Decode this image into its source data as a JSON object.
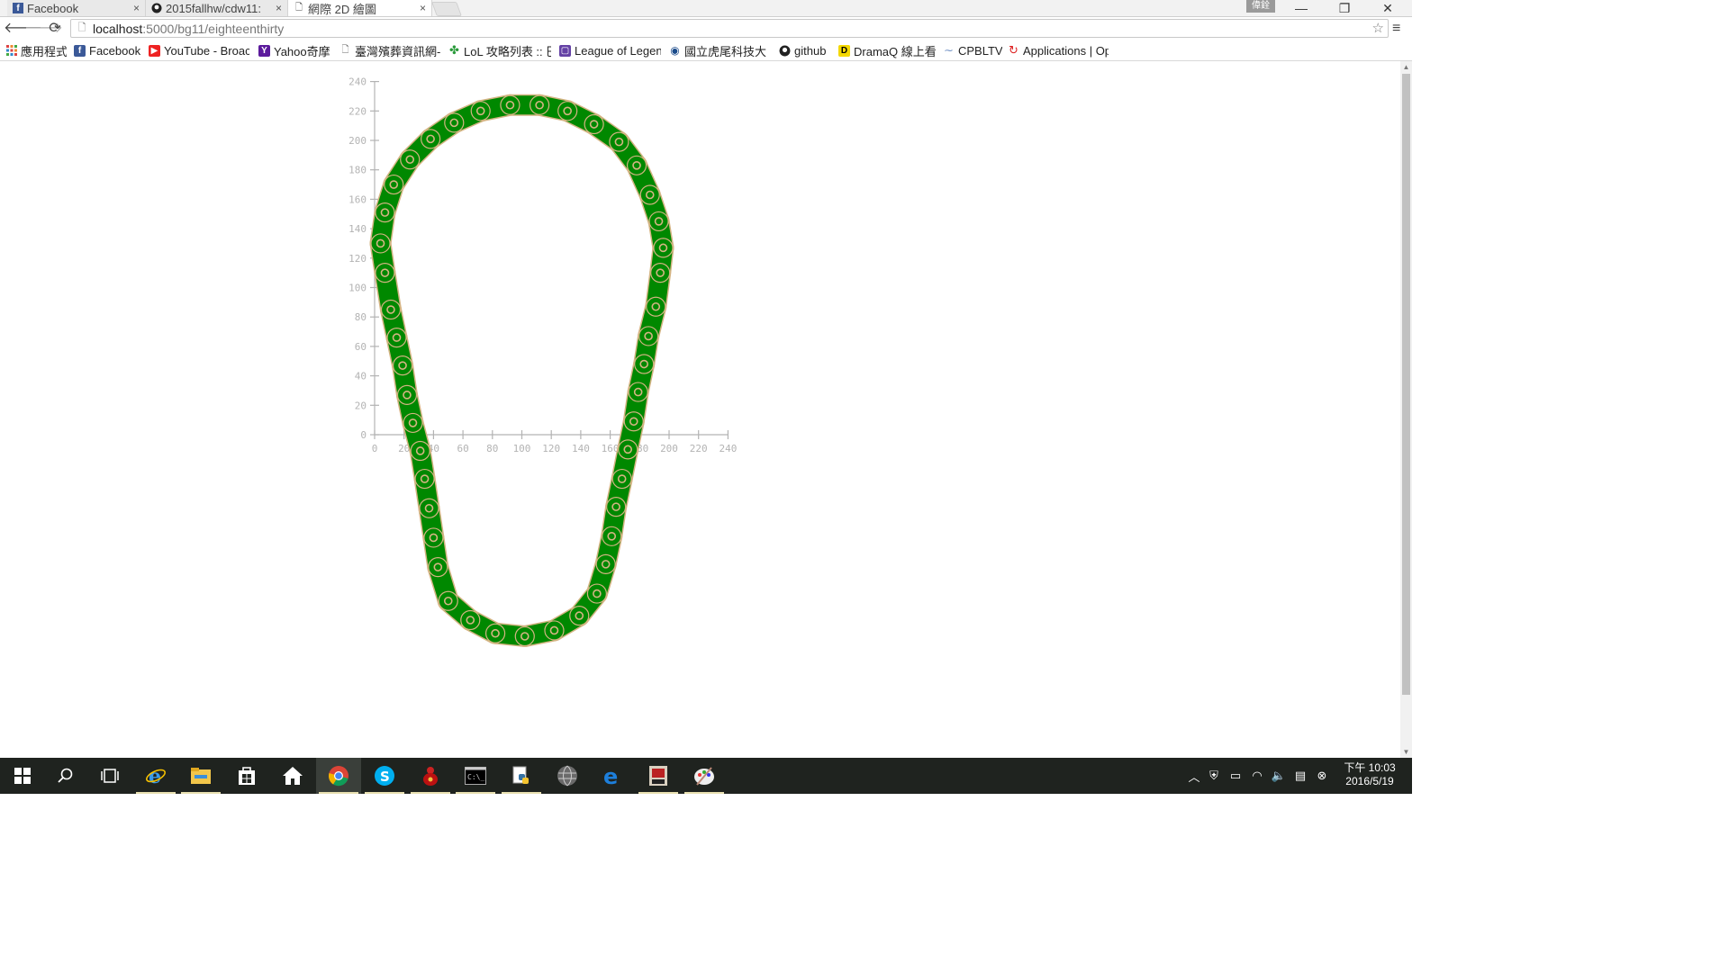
{
  "tabs": [
    {
      "label": "Facebook",
      "icon": "facebook-icon",
      "active": false
    },
    {
      "label": "2015fallhw/cdw11:",
      "icon": "github-icon",
      "active": false
    },
    {
      "label": "網際 2D 繪圖",
      "icon": "page-icon",
      "active": true
    }
  ],
  "window": {
    "profile_label": "偉銓",
    "minimize": "—",
    "restore": "❐",
    "close": "✕"
  },
  "toolbar": {
    "url_host": "localhost",
    "url_path": ":5000/bg11/eighteenthirty"
  },
  "bookmarks": [
    {
      "label": "應用程式",
      "icon": "apps-grid-icon"
    },
    {
      "label": "Facebook",
      "icon": "facebook-icon"
    },
    {
      "label": "YouTube - Broac",
      "icon": "youtube-icon"
    },
    {
      "label": "Yahoo奇摩",
      "icon": "yahoo-icon"
    },
    {
      "label": "臺灣殯葬資訊網-",
      "icon": "page-icon"
    },
    {
      "label": "LoL 攻略列表 :: 巴",
      "icon": "clover-icon"
    },
    {
      "label": "League of Legen",
      "icon": "twitch-icon"
    },
    {
      "label": "國立虎尾科技大",
      "icon": "school-icon"
    },
    {
      "label": "github",
      "icon": "github-icon"
    },
    {
      "label": "DramaQ 線上看",
      "icon": "dramaq-icon"
    },
    {
      "label": "CPBLTV",
      "icon": "cpbl-icon"
    },
    {
      "label": "Applications | Op",
      "icon": "openshift-icon"
    }
  ],
  "chart_data": {
    "type": "scatter",
    "title": "",
    "xlabel": "",
    "ylabel": "",
    "xlim": [
      0,
      240
    ],
    "ylim": [
      0,
      240
    ],
    "x_ticks": [
      0,
      20,
      40,
      60,
      80,
      100,
      120,
      140,
      160,
      180,
      200,
      220,
      240
    ],
    "y_ticks": [
      0,
      20,
      40,
      60,
      80,
      100,
      120,
      140,
      160,
      180,
      200,
      220,
      240
    ],
    "series": [
      {
        "color": "#008800",
        "outline_color": "#d4b483",
        "values_xy": [
          [
            92,
            224
          ],
          [
            112,
            224
          ],
          [
            131,
            220
          ],
          [
            149,
            211
          ],
          [
            166,
            199
          ],
          [
            178,
            183
          ],
          [
            187,
            163
          ],
          [
            193,
            145
          ],
          [
            196,
            127
          ],
          [
            194,
            110
          ],
          [
            191,
            87
          ],
          [
            186,
            67
          ],
          [
            183,
            48
          ],
          [
            179,
            29
          ],
          [
            176,
            9
          ],
          [
            172,
            -10
          ],
          [
            168,
            -30
          ],
          [
            164,
            -49
          ],
          [
            161,
            -69
          ],
          [
            157,
            -88
          ],
          [
            151,
            -108
          ],
          [
            139,
            -123
          ],
          [
            122,
            -133
          ],
          [
            102,
            -137
          ],
          [
            82,
            -135
          ],
          [
            65,
            -126
          ],
          [
            50,
            -113
          ],
          [
            43,
            -90
          ],
          [
            40,
            -70
          ],
          [
            37,
            -50
          ],
          [
            34,
            -30
          ],
          [
            31,
            -11
          ],
          [
            26,
            8
          ],
          [
            22,
            27
          ],
          [
            19,
            47
          ],
          [
            15,
            66
          ],
          [
            11,
            85
          ],
          [
            7,
            110
          ],
          [
            4,
            130
          ],
          [
            7,
            151
          ],
          [
            13,
            170
          ],
          [
            24,
            187
          ],
          [
            38,
            201
          ],
          [
            54,
            212
          ],
          [
            72,
            220
          ]
        ]
      }
    ]
  },
  "taskbar": {
    "items": [
      {
        "name": "start-button-icon"
      },
      {
        "name": "search-icon"
      },
      {
        "name": "task-view-icon"
      },
      {
        "name": "internet-explorer-icon"
      },
      {
        "name": "file-explorer-icon"
      },
      {
        "name": "store-icon"
      },
      {
        "name": "home-icon"
      },
      {
        "name": "chrome-icon"
      },
      {
        "name": "skype-icon"
      },
      {
        "name": "app-red-icon"
      },
      {
        "name": "terminal-icon"
      },
      {
        "name": "python-icon"
      },
      {
        "name": "globe-app-icon"
      },
      {
        "name": "edge-icon"
      },
      {
        "name": "app-game-icon"
      },
      {
        "name": "paint-icon"
      }
    ],
    "clock_time": "下午 10:03",
    "clock_date": "2016/5/19"
  }
}
